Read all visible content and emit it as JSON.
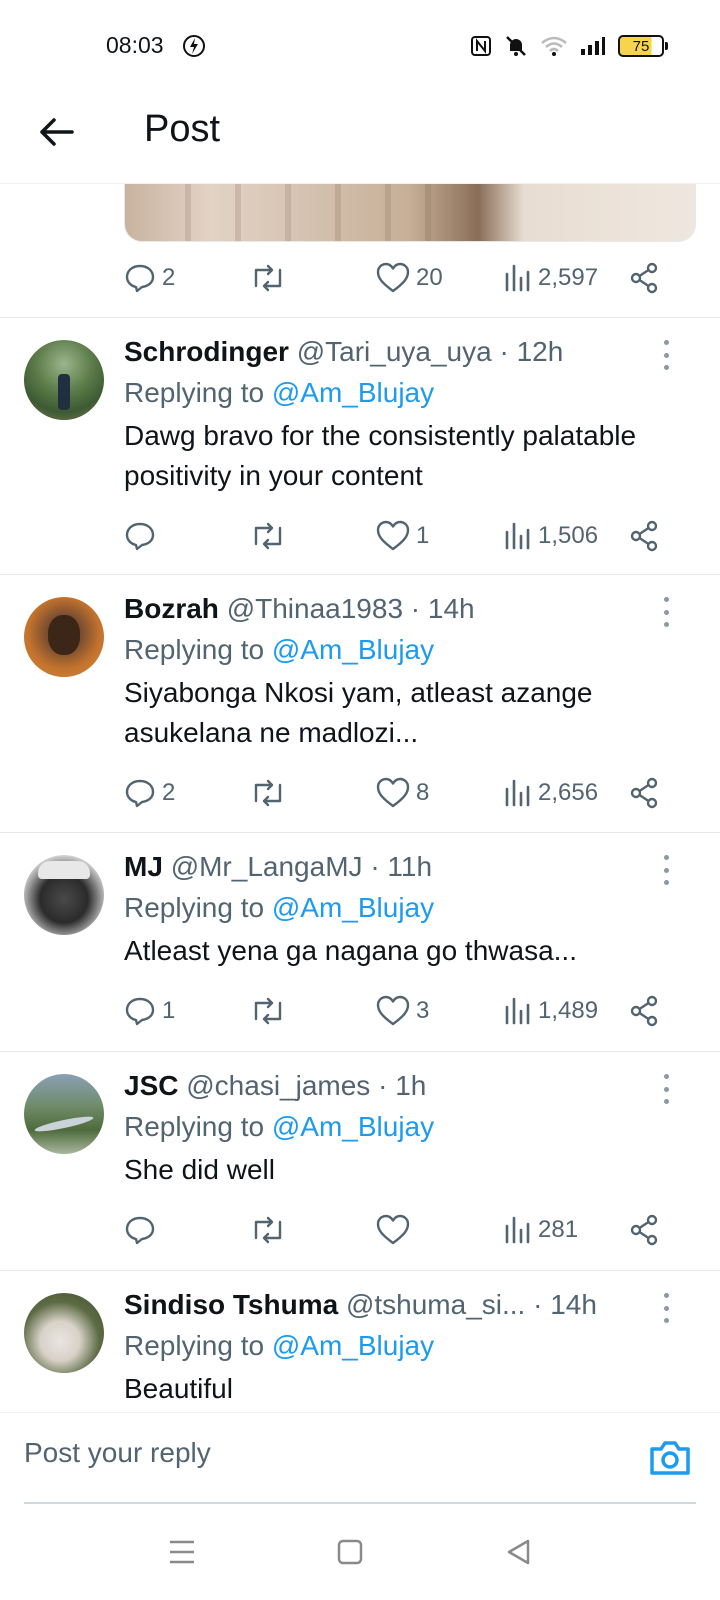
{
  "status_bar": {
    "time": "08:03",
    "battery": "75"
  },
  "header": {
    "title": "Post"
  },
  "top_post_actions": {
    "replies": "2",
    "retweets": "",
    "likes": "20",
    "views": "2,597"
  },
  "replying_label": "Replying to",
  "replies": [
    {
      "name": "Schrodinger",
      "handle": "@Tari_uya_uya",
      "time": "· 12h",
      "reply_to": "@Am_Blujay",
      "text": "Dawg bravo for the consistently palatable positivity in your content",
      "replies": "",
      "likes": "1",
      "views": "1,506"
    },
    {
      "name": "Bozrah",
      "handle": "@Thinaa1983",
      "time": "· 14h",
      "reply_to": "@Am_Blujay",
      "text": "Siyabonga Nkosi yam, atleast azange asukelana ne madlozi...",
      "replies": "2",
      "likes": "8",
      "views": "2,656"
    },
    {
      "name": "MJ",
      "handle": "@Mr_LangaMJ",
      "time": "· 11h",
      "reply_to": "@Am_Blujay",
      "text": "Atleast yena ga nagana go thwasa...",
      "replies": "1",
      "likes": "3",
      "views": "1,489"
    },
    {
      "name": "JSC",
      "handle": "@chasi_james",
      "time": "· 1h",
      "reply_to": "@Am_Blujay",
      "text": "She did well",
      "replies": "",
      "likes": "",
      "views": "281"
    },
    {
      "name": "Sindiso Tshuma",
      "handle": "@tshuma_si...",
      "time": " · 14h",
      "reply_to": "@Am_Blujay",
      "text": "Beautiful"
    }
  ],
  "composer": {
    "placeholder": "Post your reply"
  },
  "colors": {
    "accent": "#1d9bf0",
    "text": "#0f1419",
    "muted": "#536471"
  },
  "icons": [
    "back-arrow-icon",
    "reply-icon",
    "retweet-icon",
    "like-icon",
    "views-icon",
    "share-icon",
    "more-icon",
    "camera-icon",
    "menu-icon",
    "home-square-icon",
    "back-triangle-icon"
  ]
}
